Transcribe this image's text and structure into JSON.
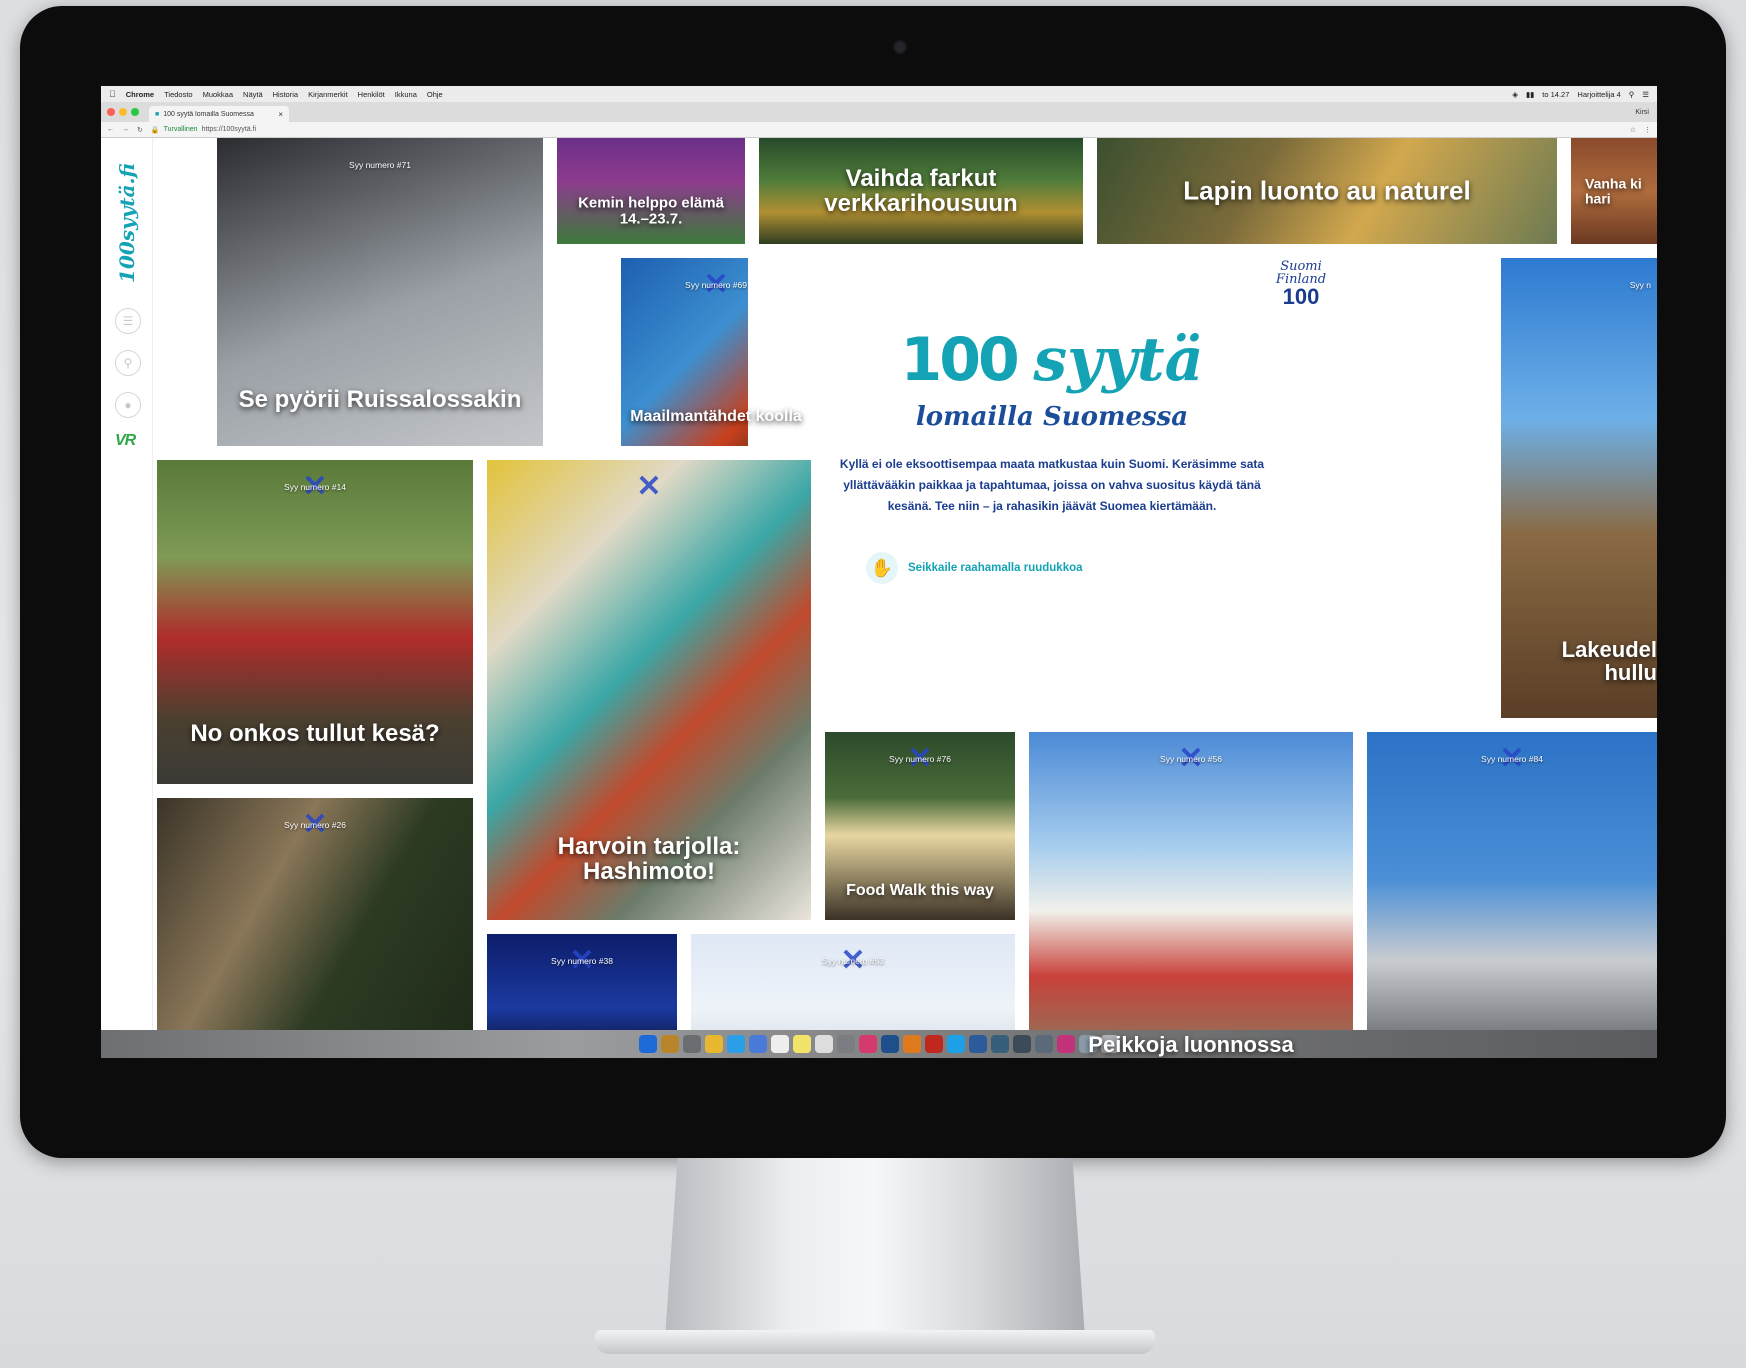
{
  "menubar": {
    "app": "Chrome",
    "items": [
      "Tiedosto",
      "Muokkaa",
      "Näytä",
      "Historia",
      "Kirjanmerkit",
      "Henkilöt",
      "Ikkuna",
      "Ohje"
    ],
    "clock": "to 14.27",
    "user": "Harjoittelija 4"
  },
  "browser": {
    "tab_title": "100 syytä lomailla Suomessa",
    "profile": "Kirsi",
    "secure_label": "Turvallinen",
    "url": "https://100syytä.fi"
  },
  "sidebar": {
    "logo": "100syytä.fi",
    "partner": "VR"
  },
  "intro": {
    "finland_script": "Suomi Finland",
    "finland_num": "100",
    "title_num": "100",
    "title_word": "syytä",
    "subtitle": "lomailla Suomessa",
    "body": "Kyllä ei ole eksoottisempaa maata matkustaa kuin Suomi. Keräsimme sata yllättävääkin paikkaa ja tapahtumaa, joissa on vahva suositus käydä tänä kesänä. Tee niin – ja rahasikin jäävät Suomea kiertämään.",
    "cta": "Seikkaile raahamalla ruudukkoa"
  },
  "tiles": {
    "cycling": {
      "badge": "Syy numero #71",
      "caption": "Se pyörii Ruissalossakin"
    },
    "kemi": {
      "caption": "Kemin helppo elämä 14.–23.7."
    },
    "farkut": {
      "caption": "Vaihda farkut verkkarihousuun"
    },
    "lappi": {
      "caption": "Lapin luonto au naturel"
    },
    "vanha": {
      "caption": "Vanha ki hari"
    },
    "javelin": {
      "badge": "Syy numero #69",
      "caption": "Maailmantähdet koolla"
    },
    "santa": {
      "badge": "Syy numero #14",
      "caption": "No onkos tullut kesä?"
    },
    "hashimoto": {
      "caption": "Harvoin tarjolla: Hashimoto!"
    },
    "lakeudet": {
      "badge": "Syy n",
      "caption": "Lakeudel hullu"
    },
    "lynx": {
      "badge": "Syy numero #26"
    },
    "foodwalk": {
      "badge": "Syy numero #76",
      "caption": "Food Walk this way"
    },
    "muumi": {
      "badge": "Syy numero #56",
      "caption": "Peikkoja luonnossa"
    },
    "husky": {
      "badge": "Syy numero #84"
    },
    "night": {
      "badge": "Syy numero #38"
    },
    "sky": {
      "badge": "Syy numero #53"
    }
  }
}
